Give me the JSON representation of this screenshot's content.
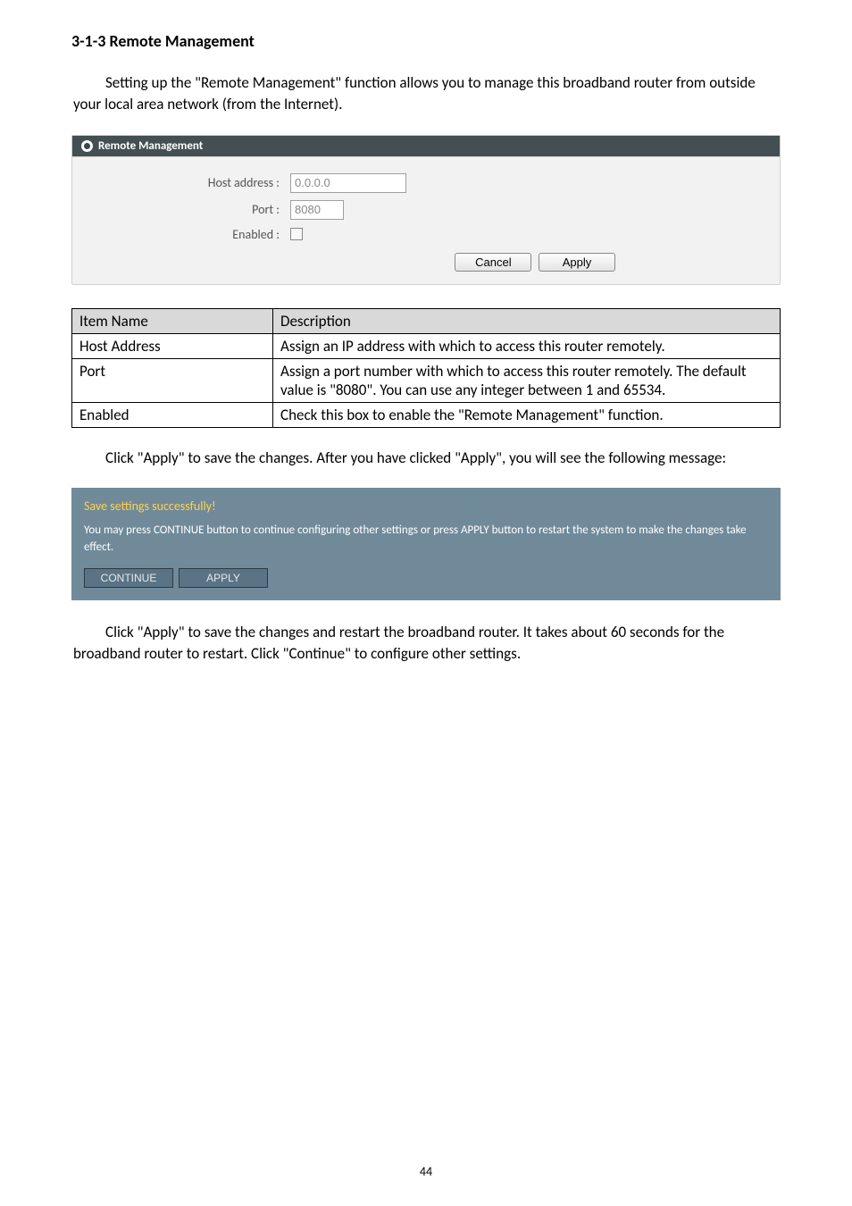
{
  "heading": "3-1-3 Remote Management",
  "intro": "Setting up the \"Remote Management\" function allows you to manage this broadband router from outside your local area network (from the Internet).",
  "panel": {
    "title": "Remote Management",
    "host_label": "Host address :",
    "host_value": "0.0.0.0",
    "port_label": "Port :",
    "port_value": "8080",
    "enabled_label": "Enabled :",
    "cancel": "Cancel",
    "apply": "Apply"
  },
  "table": {
    "headers": [
      "Item Name",
      "Description"
    ],
    "rows": [
      {
        "name": "Host Address",
        "desc": "Assign an IP address with which to access this router remotely."
      },
      {
        "name": "Port",
        "desc": "Assign a port number with which to access this router remotely. The default value is \"8080\". You can use any integer between 1 and 65534."
      },
      {
        "name": "Enabled",
        "desc": "Check this box to enable the \"Remote Management\" function."
      }
    ]
  },
  "after_table": "Click \"Apply\" to save the changes. After you have clicked \"Apply\", you will see the following message:",
  "save": {
    "title": "Save settings successfully!",
    "message": "You may press CONTINUE button to continue configuring other settings or press APPLY button to restart the system to make the changes take effect.",
    "continue": "CONTINUE",
    "apply": "APPLY"
  },
  "closing": "Click \"Apply\" to save the changes and restart the broadband router. It takes about 60 seconds for the broadband router to restart. Click \"Continue\" to configure other settings.",
  "page_number": "44"
}
